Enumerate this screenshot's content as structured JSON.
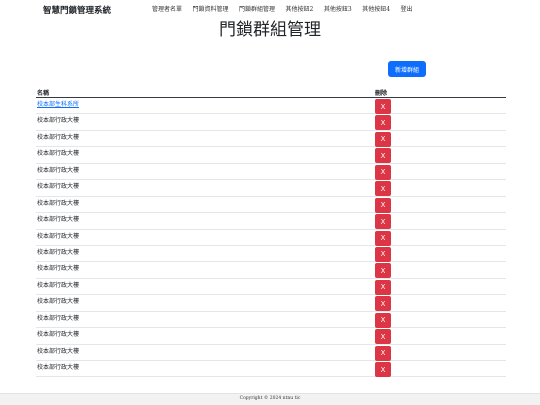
{
  "navbar": {
    "brand": "智慧門鎖管理系統",
    "items": [
      {
        "label": "管理者名單"
      },
      {
        "label": "門鎖資料管理"
      },
      {
        "label": "門鎖群組管理"
      },
      {
        "label": "其他按鈕2"
      },
      {
        "label": "其他按鈕3"
      },
      {
        "label": "其他按鈕4"
      },
      {
        "label": "登出"
      }
    ]
  },
  "page": {
    "title": "門鎖群組管理",
    "add_button_label": "新增群組"
  },
  "table": {
    "headers": {
      "name": "名稱",
      "delete": "刪除"
    },
    "delete_label": "X",
    "rows": [
      {
        "name": "校本部生科系所"
      },
      {
        "name": "校本部行政大樓"
      },
      {
        "name": "校本部行政大樓"
      },
      {
        "name": "校本部行政大樓"
      },
      {
        "name": "校本部行政大樓"
      },
      {
        "name": "校本部行政大樓"
      },
      {
        "name": "校本部行政大樓"
      },
      {
        "name": "校本部行政大樓"
      },
      {
        "name": "校本部行政大樓"
      },
      {
        "name": "校本部行政大樓"
      },
      {
        "name": "校本部行政大樓"
      },
      {
        "name": "校本部行政大樓"
      },
      {
        "name": "校本部行政大樓"
      },
      {
        "name": "校本部行政大樓"
      },
      {
        "name": "校本部行政大樓"
      },
      {
        "name": "校本部行政大樓"
      },
      {
        "name": "校本部行政大樓"
      }
    ]
  },
  "footer": {
    "text": "Copyright © 2024 ntnu tic"
  },
  "colors": {
    "primary": "#0d6efd",
    "danger": "#dc3545",
    "link": "#0d6efd",
    "footer_bg": "#f2f2f2"
  }
}
